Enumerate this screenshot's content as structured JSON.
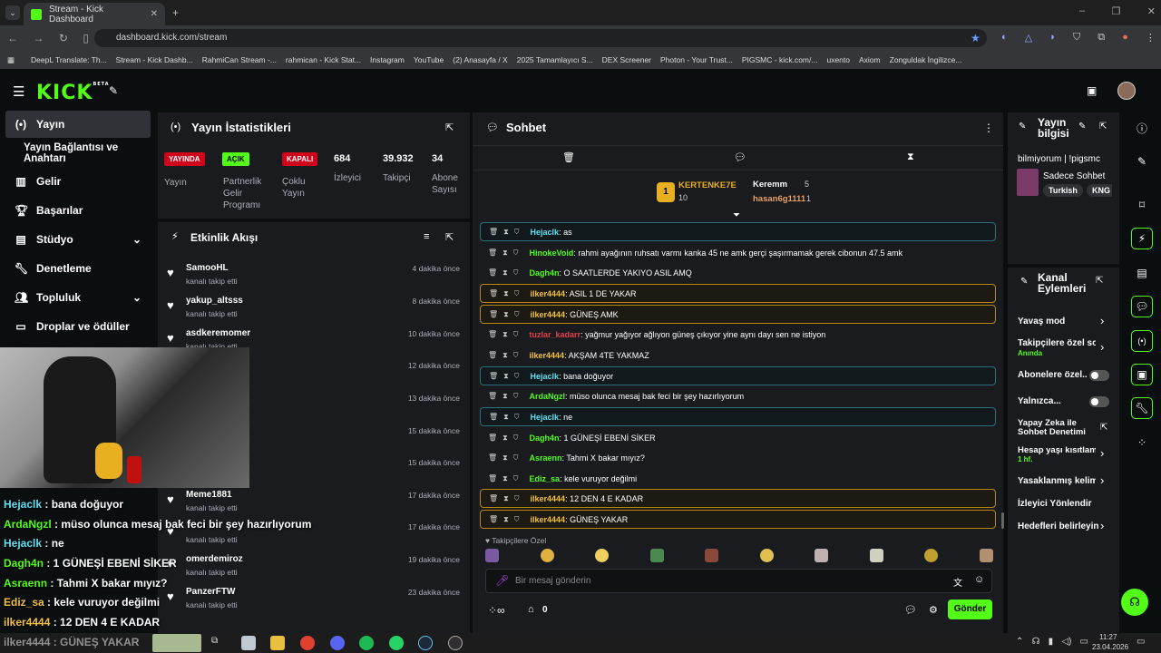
{
  "browser": {
    "tab_title": "Stream - Kick Dashboard",
    "url": "dashboard.kick.com/stream",
    "bookmarks": [
      "DeepL Translate: Th...",
      "Stream - Kick Dashb...",
      "RahmiCan Stream -...",
      "rahmican - Kick Stat...",
      "Instagram",
      "YouTube",
      "(2) Anasayfa / X",
      "2025 Tamamlayıcı S...",
      "DEX Screener",
      "Photon - Your Trust...",
      "PIGSMC - kick.com/...",
      "uxento",
      "Axiom",
      "Zonguldak İngilizce..."
    ]
  },
  "app": {
    "logo": "KICK",
    "logo_sup": "BETA"
  },
  "sidebar": {
    "items": [
      {
        "label": "Yayın",
        "icon": "broadcast-icon"
      },
      {
        "label": "Yayın Bağlantısı ve Anahtarı",
        "icon": ""
      },
      {
        "label": "Gelir",
        "icon": "chart-icon"
      },
      {
        "label": "Başarılar",
        "icon": "trophy-icon"
      },
      {
        "label": "Stüdyo",
        "icon": "studio-icon"
      },
      {
        "label": "Denetleme",
        "icon": "wrench-icon"
      },
      {
        "label": "Topluluk",
        "icon": "community-icon"
      },
      {
        "label": "Droplar ve ödüller",
        "icon": "gift-icon"
      }
    ]
  },
  "stats": {
    "title": "Yayın İstatistikleri",
    "status": {
      "badge": "YAYINDA",
      "label": "Yayın"
    },
    "partner": {
      "badge": "AÇIK",
      "label": "Partnerlik Gelir Programı"
    },
    "multi": {
      "badge": "KAPALI",
      "label": "Çoklu Yayın"
    },
    "viewers": {
      "value": "684",
      "label": "İzleyici"
    },
    "followers": {
      "value": "39.932",
      "label": "Takipçi"
    },
    "subs": {
      "value": "34",
      "label": "Abone Sayısı"
    }
  },
  "activity": {
    "title": "Etkinlik Akışı",
    "items": [
      {
        "name": "SamooHL",
        "action": "kanalı takip etti",
        "time": "4 dakika önce"
      },
      {
        "name": "yakup_altsss",
        "action": "kanalı takip etti",
        "time": "8 dakika önce"
      },
      {
        "name": "asdkeremomer",
        "action": "kanalı takip etti",
        "time": "10 dakika önce"
      },
      {
        "name": "",
        "action": "",
        "time": "12 dakika önce"
      },
      {
        "name": "",
        "action": "",
        "time": "13 dakika önce"
      },
      {
        "name": "",
        "action": "",
        "time": "15 dakika önce"
      },
      {
        "name": "",
        "action": "",
        "time": "15 dakika önce"
      },
      {
        "name": "Meme1881",
        "action": "kanalı takip etti",
        "time": "17 dakika önce"
      },
      {
        "name": "",
        "action": "kanalı takip etti",
        "time": "17 dakika önce"
      },
      {
        "name": "omerdemiroz",
        "action": "kanalı takip etti",
        "time": "19 dakika önce"
      },
      {
        "name": "PanzerFTW",
        "action": "kanalı takip etti",
        "time": "23 dakika önce"
      }
    ]
  },
  "chat": {
    "title": "Sohbet",
    "leaderboard": {
      "first": {
        "name": "KERTENKE7E",
        "count": "10",
        "rank": "1"
      },
      "second": {
        "name": "Keremm",
        "count": "5"
      },
      "third": {
        "name": "hasan6g1111",
        "count": "1"
      }
    },
    "messages": [
      {
        "user": "Hejaclk",
        "text": ": as",
        "color": "#5ee0f0",
        "hl": "c"
      },
      {
        "user": "HinokeVoid",
        "text": ": rahmi ayağının ruhsatı varmı kanka 45 ne amk gerçi şaşırmamak gerek cibonun 47.5 amk",
        "color": "#53fc18",
        "hl": ""
      },
      {
        "user": "Dagh4n",
        "text": ": O SAATLERDE YAKIYO ASIL AMQ",
        "color": "#53fc18",
        "hl": ""
      },
      {
        "user": "ilker4444",
        "text": ": ASIL 1 DE YAKAR",
        "color": "#f0c040",
        "hl": "y"
      },
      {
        "user": "ilker4444",
        "text": ": GÜNEŞ AMK",
        "color": "#f0c040",
        "hl": "y"
      },
      {
        "user": "tuzlar_kadarr",
        "text": ": yağmur yağıyor ağlıyon güneş çıkıyor yine aynı dayı sen ne istiyon",
        "color": "#e0404a",
        "hl": ""
      },
      {
        "user": "ilker4444",
        "text": ": AKŞAM 4TE YAKMAZ",
        "color": "#f0c040",
        "hl": ""
      },
      {
        "user": "Hejaclk",
        "text": ": bana doğuyor",
        "color": "#5ee0f0",
        "hl": "c"
      },
      {
        "user": "ArdaNgzl",
        "text": ": müso olunca mesaj bak feci bir şey hazırlıyorum",
        "color": "#53fc18",
        "hl": ""
      },
      {
        "user": "Hejaclk",
        "text": ": ne",
        "color": "#5ee0f0",
        "hl": "c"
      },
      {
        "user": "Dagh4n",
        "text": ": 1 GÜNEŞİ EBENİ SİKER",
        "color": "#53fc18",
        "hl": ""
      },
      {
        "user": "Asraenn",
        "text": ": Tahmi X bakar mıyız?",
        "color": "#53fc18",
        "hl": ""
      },
      {
        "user": "Ediz_sa",
        "text": ": kele vuruyor değilmi",
        "color": "#53fc18",
        "hl": ""
      },
      {
        "user": "ilker4444",
        "text": ": 12 DEN 4 E KADAR",
        "color": "#f0c040",
        "hl": "y"
      },
      {
        "user": "ilker4444",
        "text": ": GÜNEŞ YAKAR",
        "color": "#f0c040",
        "hl": "y"
      }
    ],
    "emote_label": "Takipçilere Özel",
    "input_placeholder": "Bir mesaj gönderin",
    "send_label": "Gönder",
    "bottom_count": "0"
  },
  "stream_info": {
    "title": "Yayın bilgisi",
    "stream_title": "bilmiyorum | !pigsmc",
    "category": "Sadece Sohbet",
    "tags": [
      "Turkish",
      "KNG"
    ]
  },
  "channel_actions": {
    "title": "Kanal Eylemleri",
    "items": [
      {
        "label": "Yavaş mod",
        "sub": "",
        "ctrl": "chevron"
      },
      {
        "label": "Takipçilere özel soh",
        "sub": "Anında",
        "ctrl": "chevron"
      },
      {
        "label": "Abonelere özel...",
        "sub": "",
        "ctrl": "toggle"
      },
      {
        "label": "Yalnızca...",
        "sub": "",
        "ctrl": "toggle"
      },
      {
        "label": "Yapay Zeka ile Sohbet Denetimi",
        "sub": "",
        "ctrl": "ext"
      },
      {
        "label": "Hesap yaşı kısıtlam",
        "sub": "1 hf.",
        "ctrl": "chevron"
      },
      {
        "label": "Yasaklanmış kelime",
        "sub": "",
        "ctrl": "chevron"
      },
      {
        "label": "İzleyici Yönlendir",
        "sub": "",
        "ctrl": ""
      },
      {
        "label": "Hedefleri belirleyin",
        "sub": "",
        "ctrl": "chevron"
      }
    ]
  },
  "overlay": {
    "lines": [
      {
        "user": "Hejaclk",
        "text": " : bana doğuyor",
        "color": "#5ee0f0"
      },
      {
        "user": "ArdaNgzl",
        "text": " : müso olunca mesaj bak feci bir şey hazırlıyorum",
        "color": "#53fc18"
      },
      {
        "user": "Hejaclk",
        "text": " : ne",
        "color": "#5ee0f0"
      },
      {
        "user": "Dagh4n",
        "text": " : 1 GÜNEŞİ EBENİ SİKER",
        "color": "#53fc18"
      },
      {
        "user": "Asraenn",
        "text": " : Tahmi X bakar mıyız?",
        "color": "#53fc18"
      },
      {
        "user": "Ediz_sa",
        "text": " : kele vuruyor değilmi",
        "color": "#f0c040"
      },
      {
        "user": "ilker4444",
        "text": " : 12 DEN 4 E KADAR",
        "color": "#f0c040"
      },
      {
        "user": "ilker4444",
        "text": " : GÜNEŞ YAKAR",
        "color": "#f0c040"
      }
    ]
  },
  "taskbar": {
    "time": "11:27",
    "date": "23.04.2026"
  },
  "colors": {
    "accent": "#53fc18",
    "live": "#d0021b",
    "panel": "#191b1f",
    "bg": "#0b0e0f"
  }
}
